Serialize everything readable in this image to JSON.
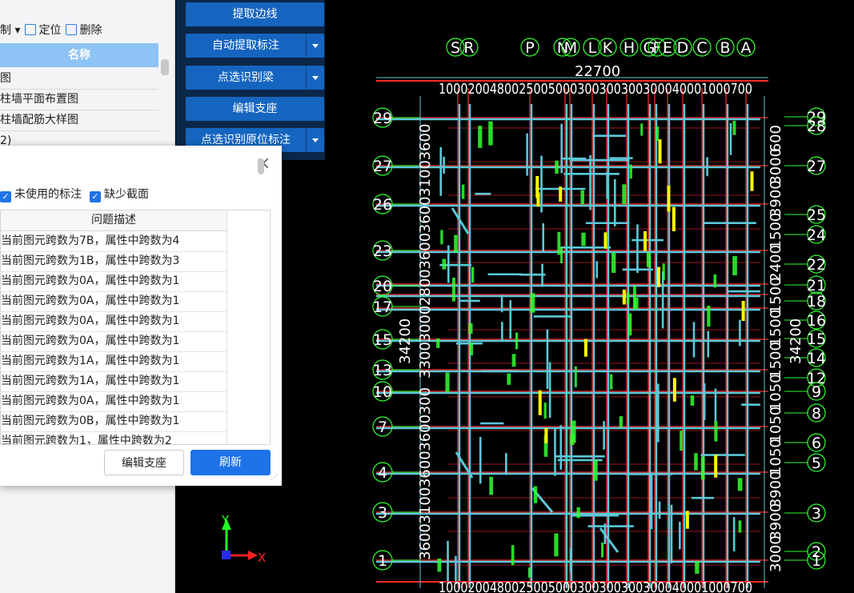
{
  "left_panel": {
    "toolbar": {
      "item1": "制",
      "locate": "定位",
      "delete": "删除"
    },
    "header": "名称",
    "rows": [
      "图",
      "柱墙平面布置图",
      "柱墙配筋大样图",
      "2)"
    ]
  },
  "command_menu": {
    "items": [
      {
        "label": "提取边线",
        "has_dropdown": false
      },
      {
        "label": "自动提取标注",
        "has_dropdown": true
      },
      {
        "label": "点选识别梁",
        "has_dropdown": true
      },
      {
        "label": "编辑支座",
        "has_dropdown": false
      },
      {
        "label": "点选识别原位标注",
        "has_dropdown": true
      }
    ]
  },
  "dialog": {
    "close_icon": "×",
    "filters": [
      {
        "label": "未使用的标注",
        "checked": true
      },
      {
        "label": "缺少截面",
        "checked": true
      }
    ],
    "column_header": "问题描述",
    "rows": [
      "当前图元跨数为7B，属性中跨数为4",
      "当前图元跨数为1B，属性中跨数为3",
      "当前图元跨数为0A，属性中跨数为1",
      "当前图元跨数为0A，属性中跨数为1",
      "当前图元跨数为0A，属性中跨数为1",
      "当前图元跨数为0A，属性中跨数为1",
      "当前图元跨数为1A，属性中跨数为1",
      "当前图元跨数为1A，属性中跨数为1",
      "当前图元跨数为0A，属性中跨数为1",
      "当前图元跨数为0B，属性中跨数为1",
      "当前图元跨数为1，属性中跨数为2"
    ],
    "edit_button": "编辑支座",
    "refresh_button": "刷新"
  },
  "drawing": {
    "top_axes": [
      "S",
      "R",
      "P",
      "N",
      "M",
      "L",
      "K",
      "H",
      "G",
      "F",
      "E",
      "D",
      "C",
      "B",
      "A"
    ],
    "overall_width": "22700",
    "top_dims": "1000200480025005000300300300300040001000700",
    "bottom_dims": "1000200480025005000300300300300040001000700",
    "left_axes": [
      "29",
      "27",
      "26",
      "23",
      "20",
      "17",
      "15",
      "13",
      "10",
      "7",
      "4",
      "3",
      "1"
    ],
    "right_axes": [
      "29",
      "28",
      "27",
      "25",
      "24",
      "22",
      "21",
      "18",
      "16",
      "15",
      "14",
      "12",
      "9",
      "8",
      "6",
      "5",
      "3",
      "2",
      "1"
    ],
    "overall_height": "34200",
    "left_dims": [
      "3600",
      "3100",
      "3600",
      "3600",
      "300",
      "3300",
      "3000",
      "2800",
      "3600",
      "3600",
      "3100",
      "3600"
    ],
    "right_dims": [
      "3000",
      "3900",
      "3900",
      "1050",
      "1050",
      "1050",
      "1500",
      "1500",
      "1500",
      "2400",
      "1500",
      "3900",
      "3000",
      "600"
    ],
    "colors": {
      "beam": "#5cc8d8",
      "axis": "#ff2a2a",
      "annotation": "#30ff30",
      "highlight": "#ffff00",
      "text": "#ffffff"
    }
  },
  "ucs": {
    "x": "X",
    "y": "Y"
  }
}
